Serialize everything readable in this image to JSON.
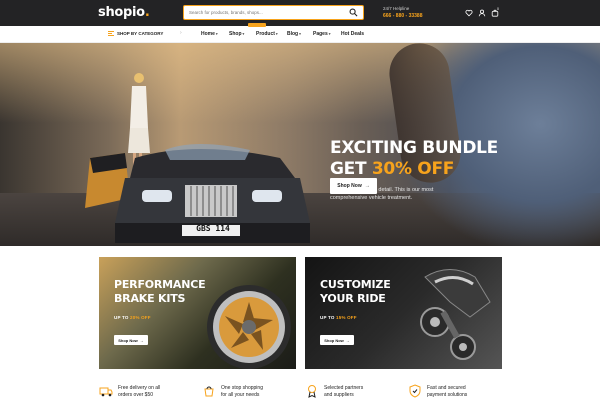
{
  "header": {
    "logo_text": "shopio",
    "logo_dot": ".",
    "search_placeholder": "Search for products, brands, shops...",
    "helpline_label": "24/7 Helpline",
    "helpline_number": "666 - 880 - 33388",
    "cart_count": "0",
    "icons": [
      "heart-icon",
      "user-icon",
      "cart-icon",
      "search-icon"
    ]
  },
  "nav": {
    "category_label": "SHOP BY CATEGORY",
    "items": [
      {
        "label": "Home"
      },
      {
        "label": "Shop"
      },
      {
        "label": "Product"
      },
      {
        "label": "Blog"
      },
      {
        "label": "Pages"
      },
      {
        "label": "Hot Deals"
      }
    ]
  },
  "hero": {
    "line1": "EXCITING BUNDLE",
    "line2_prefix": "GET ",
    "line2_accent": "30% OFF",
    "subtitle": "Bigfoot's in-posture detail. This is our most comprehensive vehicle treatment.",
    "button_label": "Shop Now",
    "plate_text": "GBS 114"
  },
  "banners": [
    {
      "title_line1": "PERFORMANCE",
      "title_line2": "BRAKE KITS",
      "promo_prefix": "UP TO ",
      "promo_accent": "20% OFF",
      "button_label": "Shop Now"
    },
    {
      "title_line1": "CUSTOMIZE",
      "title_line2": "YOUR RIDE",
      "promo_prefix": "UP TO ",
      "promo_accent": "15% OFF",
      "button_label": "Shop Now"
    }
  ],
  "features": [
    {
      "icon": "truck-icon",
      "line1": "Free delivery on all",
      "line2": "orders over $50"
    },
    {
      "icon": "shopping-icon",
      "line1": "One stop shopping",
      "line2": "for all your needs"
    },
    {
      "icon": "award-icon",
      "line1": "Selected partners",
      "line2": "and suppliers"
    },
    {
      "icon": "secure-payment-icon",
      "line1": "Fast and secured",
      "line2": "payment solutions"
    }
  ],
  "colors": {
    "accent": "#f7a31c",
    "header_bg": "#232325",
    "white": "#ffffff"
  }
}
